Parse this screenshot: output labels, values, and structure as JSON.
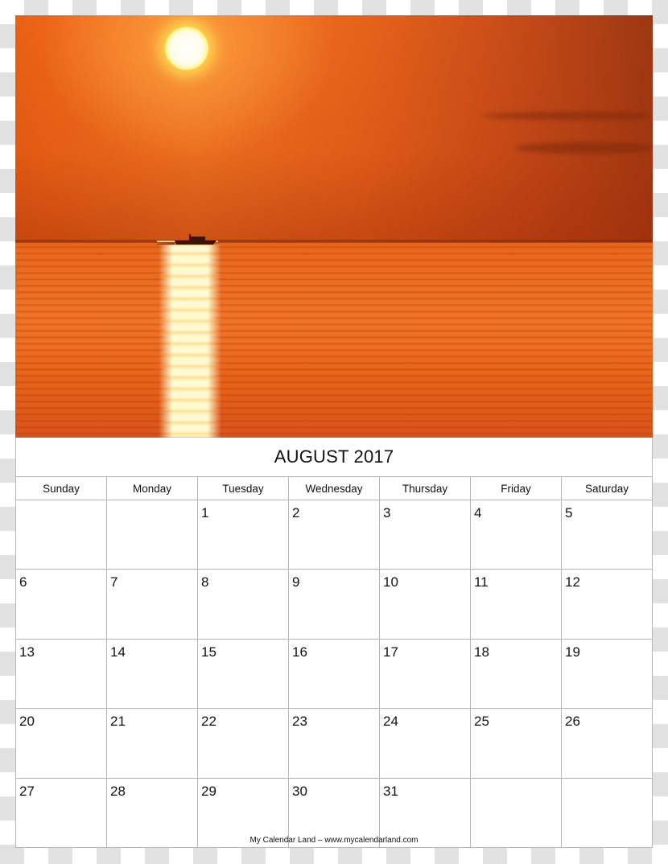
{
  "photo": {
    "description": "Orange sunset over the sea with a boat silhouette on the horizon",
    "colors": {
      "sky": "#f47420",
      "sun": "#fffbe8",
      "water": "#ec6c22",
      "shadow": "#933110"
    }
  },
  "calendar": {
    "title": "AUGUST 2017",
    "weekdays": [
      "Sunday",
      "Monday",
      "Tuesday",
      "Wednesday",
      "Thursday",
      "Friday",
      "Saturday"
    ],
    "weeks": [
      [
        "",
        "",
        "1",
        "2",
        "3",
        "4",
        "5"
      ],
      [
        "6",
        "7",
        "8",
        "9",
        "10",
        "11",
        "12"
      ],
      [
        "13",
        "14",
        "15",
        "16",
        "17",
        "18",
        "19"
      ],
      [
        "20",
        "21",
        "22",
        "23",
        "24",
        "25",
        "26"
      ],
      [
        "27",
        "28",
        "29",
        "30",
        "31",
        "",
        ""
      ]
    ]
  },
  "footer": {
    "text": "My Calendar Land – www.mycalendarland.com"
  }
}
